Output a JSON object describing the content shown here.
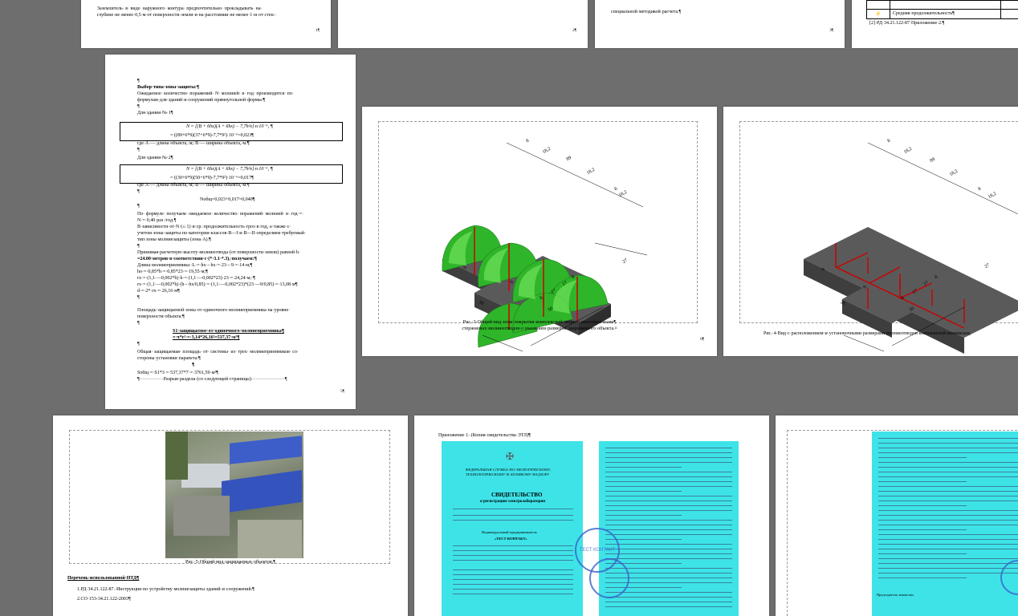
{
  "top_pages": {
    "p1_line1": "Заземлитель· в· виде· наружного· контура· предпочтительно· прокладывать· на·",
    "p1_line2": "глубине·не·менее·0,5·м·от·поверхности·земли·и·на·расстоянии·не·менее·1·м·от·стен.·",
    "p1_num": "1¶",
    "p2_num": "2¶",
    "p3_line": "специальной·методикой·расчета.¶",
    "p3_num": "3¶",
    "p4_row": "Средняя·продолжительность¶",
    "p4_ref": "[2]·РД·34.21.122-87·Приложение·2.¶"
  },
  "calc_page": {
    "lines": [
      "¶",
      "Выбор·типа·зоны·защиты:¶",
      "Ожидаемое· количество· поражений· N· молнией· в· год· производится· по·",
      "формулам·для·зданий·и·сооружений·прямоугольной·формы:¶",
      "¶",
      "Для·здания·№·1¶",
      "где·A·—·длина·объекта,·м;·B·—·ширина·объекта,·м.¶",
      "¶",
      "Для·здания·№·2¶",
      "где·A·—·длина·объекта,·м;·B·—·ширина·объекта,·м.¶",
      "¶",
      "Nобщ=0,023+0,017=0,040¶",
      "¶",
      "По· формуле· получаем· ожидаемое· количество· поражений· молнией· в· год·=·",
      "N·=·0,40·раз·/год.¶",
      "В·зависимости·от·N·(≤·1)·и·ср.·продолжительность·гроз·в·год,·а·также·с·",
      "учетом·зоны·защиты·по·категории·классов·B—I·и·B—II·определяем·требуемый·",
      "тип·зоны·молниезащиты·(зона·А).¶",
      "¶",
      "Принимая·расчетную·высоту·молниеотвода·(от·поверхности·земли)·равной·h·",
      "=24.00·метров·в·соответствии·с·(*·3.1·*.3),·получаем:¶",
      "Длина·молниеприемника:·L·=·hx·-·hx·=·23·-·9·=·14·м;¶",
      "ho·=·0,85*h·=·0,85*23·=·19,55·м;¶",
      "rx·=·(1,1·—0,002*h)·h·=·(1,1·—0,002*23)·23·=·24,24·м;·¶",
      "rx·=·(1,1·—0,002*h)·(h·-·hx/0,85)·=·(1,1·—0,002*23)*(23·—9/0,85)·=·13,08·м¶",
      "d·=·2*·rx·=·26,16·м¶",
      "¶",
      "Площадь·защищаемой·зоны·от·одиночного·молниеприемника·на·уровне·",
      "поверхности·объекта:¶",
      "¶",
      "S1·защищаемое·от·одиночного·молниеприемника¶",
      "=·π*r²·=·3,14*26,16²=537,37·м²¶",
      "¶",
      "Общая· защищаемая· площадь· от· системы· из· трех· молниеприемников· со·",
      "стороны·установки·парапета:¶",
      "¶",
      "Sобщ·=·S1*3·=·537,37*7·=·3761,59·м²¶",
      "¶···············Разрыв·раздела·(со·следующей·страницы)·····················¶"
    ],
    "formula1_a": "N = [(B + 6hx)(A + 6hx) − 7,7h²x]·n·10⁻⁶, ¶",
    "formula1_b": "= ((89+6*9)(37+6*9)-7,7*9²)·10⁻⁶=0,023¶",
    "formula2_a": "N = [(B + 6hx)(A + 6hx) − 7,7h²x]·n·10⁻⁶, ¶",
    "formula2_b": "= ((30+6*9)(50+6*9)-7,7*9²)·10⁻⁶=0,017¶",
    "page_num": "5¶"
  },
  "figure3": {
    "caption_line1": "Рис.·3·Общий·вид·зоны·покрытия·комплексной·защиты·многократными¶",
    "caption_line2": "стержневых·молниеотводов·с·указанием·размеров·защищаемого·объекта.¤",
    "dims": [
      "8",
      "18,2",
      "89",
      "18,2",
      "8",
      "18,2",
      "27",
      "30",
      "8",
      "17",
      "17",
      "8",
      "50",
      "9",
      "9"
    ],
    "page_num": "6¶"
  },
  "figure4": {
    "caption": "Рис.·4·Вид·с·расположением·и·установочными·размерами·молниеотводов·комплексной·молниезащ",
    "dims": [
      "8",
      "18,2",
      "89",
      "18,2",
      "8",
      "18,2",
      "27",
      "30",
      "8",
      "17",
      "17",
      "8",
      "50",
      "9",
      "9"
    ]
  },
  "figure5": {
    "caption": "Рис.·5·Общий·вид·защищаемых·объектов.¶"
  },
  "references": {
    "title": "Перечень·использованной·НТД¶",
    "items": [
      "1.РД·34.21.122-87.·Инструкция·по·устройству·молниезащиты·зданий·и·сооружений.¶",
      "2.СО·153-34.21.122-2003¶"
    ]
  },
  "appendix": {
    "title": "Приложение·1.·(Копия·свидетельства·ЭТЛ)¶",
    "cert_header1": "ФЕДЕРАЛЬНАЯ·СЛУЖБА·ПО·ЭКОЛОГИЧЕСКОМУ,",
    "cert_header2": "ТЕХНОЛОГИЧЕСКОМУ·И·АТОМНОМУ·НАДЗОРУ",
    "cert_title": "СВИДЕТЕЛЬСТВО",
    "cert_subtitle": "о·регистрации·электролаборатории",
    "cert_org": "Индивидуальный·предприниматель",
    "cert_company": "«ТЕСТ·КОНТАКТ»",
    "stamp_text": "ТЕСТ КОНТАКТ",
    "cert_footer": "Председатель·комиссии"
  }
}
